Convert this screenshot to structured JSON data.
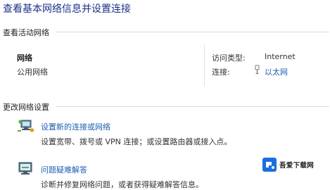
{
  "header": {
    "title": "查看基本网络信息并设置连接"
  },
  "active_networks": {
    "section_title": "查看活动网络",
    "network": {
      "name": "网络",
      "type": "公用网络"
    },
    "access_type_label": "访问类型:",
    "access_type_value": "Internet",
    "connection_label": "连接:",
    "connection_value": "以太网"
  },
  "change_settings": {
    "section_title": "更改网络设置",
    "tasks": [
      {
        "link": "设置新的连接或网络",
        "description": "设置宽带、拨号或 VPN 连接；或设置路由器或接入点。"
      },
      {
        "link": "问题疑难解答",
        "description": "诊断并修复网络问题，或者获得疑难解答信息。"
      }
    ]
  },
  "watermark": {
    "text": "吾爱下载网",
    "accent": "#1a6fe0"
  },
  "colors": {
    "link": "#1c5fb0",
    "title": "#1e3287"
  }
}
